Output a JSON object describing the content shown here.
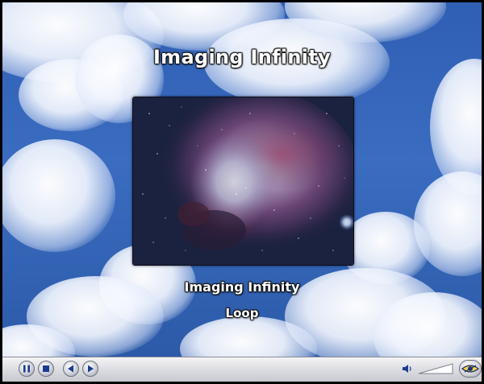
{
  "presentation": {
    "title": "Imaging Infinity",
    "caption": "Imaging Infinity",
    "subcaption": "Loop"
  },
  "controls": {
    "pause_icon": "pause-icon",
    "stop_icon": "stop-icon",
    "previous_icon": "previous-icon",
    "next_icon": "next-icon",
    "volume_icon": "speaker-icon",
    "mode_icon": "eye-icon"
  },
  "colors": {
    "sky": "#3a6cc0",
    "control_bar": "#dcdde2",
    "accent_icon": "#1a3b8f"
  }
}
